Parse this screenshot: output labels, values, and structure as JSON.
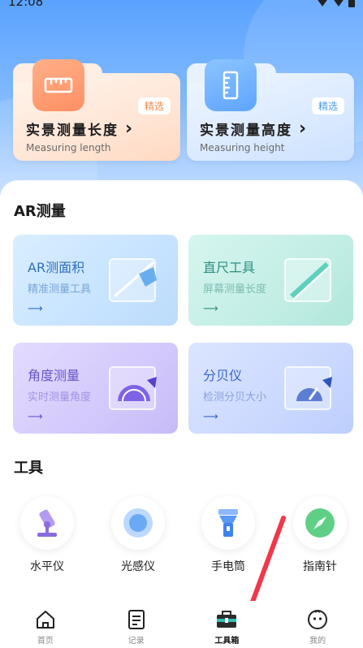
{
  "status_bar": {
    "time": "12:08"
  },
  "measure_cards": [
    {
      "title": "实景测量长度",
      "subtitle": "Measuring length",
      "badge": "精选",
      "chevron": "›",
      "icon": "ruler-icon"
    },
    {
      "title": "实景测量高度",
      "subtitle": "Measuring height",
      "badge": "精选",
      "chevron": "›",
      "icon": "height-ruler-icon"
    }
  ],
  "ar_section": {
    "title": "AR测量",
    "cards": [
      {
        "title": "AR测面积",
        "subtitle": "精准测量工具",
        "arrow": "⟶",
        "icon": "area-icon"
      },
      {
        "title": "直尺工具",
        "subtitle": "屏幕测量长度",
        "arrow": "⟶",
        "icon": "ruler-tool-icon"
      },
      {
        "title": "角度测量",
        "subtitle": "实时测量角度",
        "arrow": "⟶",
        "icon": "protractor-icon"
      },
      {
        "title": "分贝仪",
        "subtitle": "检测分贝大小",
        "arrow": "⟶",
        "icon": "decibel-icon"
      }
    ]
  },
  "tools_section": {
    "title": "工具",
    "items": [
      {
        "label": "水平仪",
        "icon": "level-icon"
      },
      {
        "label": "光感仪",
        "icon": "light-sensor-icon"
      },
      {
        "label": "手电筒",
        "icon": "flashlight-icon"
      },
      {
        "label": "指南针",
        "icon": "compass-icon"
      }
    ]
  },
  "bottom_nav": {
    "items": [
      {
        "label": "首页",
        "icon": "home-icon"
      },
      {
        "label": "记录",
        "icon": "record-icon"
      },
      {
        "label": "工具箱",
        "icon": "toolbox-icon",
        "active": true
      },
      {
        "label": "我的",
        "icon": "profile-icon"
      }
    ]
  },
  "colors": {
    "hero_top": "#5aa2ff",
    "length_accent": "#ff8f63",
    "height_accent": "#5ea4ff",
    "active_nav": "#111111",
    "annotation_arrow": "#f0384a"
  }
}
